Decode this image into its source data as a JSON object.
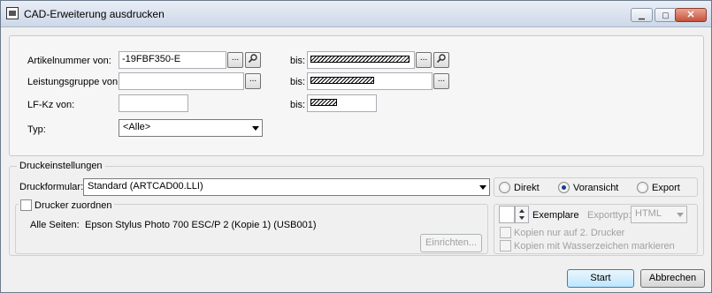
{
  "window": {
    "title": "CAD-Erweiterung ausdrucken",
    "min_label": "▁",
    "max_label": "▢",
    "close_label": "✕"
  },
  "filters": {
    "artikel_von_label": "Artikelnummer von:",
    "artikel_von_value": "-19FBF350-E",
    "artikel_bis_label": "bis:",
    "leistung_von_label": "Leistungsgruppe von:",
    "leistung_bis_label": "bis:",
    "lfkz_von_label": "LF-Kz von:",
    "lfkz_bis_label": "bis:",
    "typ_label": "Typ:",
    "typ_value": "<Alle>",
    "browse_label": "...",
    "search_icon": "magnifier-icon"
  },
  "print": {
    "group_title": "Druckeinstellungen",
    "formular_label": "Druckformular:",
    "formular_value": "Standard (ARTCAD00.LLI)",
    "radio_direkt": "Direkt",
    "radio_voransicht": "Voransicht",
    "radio_export": "Export",
    "selected_output": "Voransicht",
    "drucker_zuordnen_label": "Drucker zuordnen",
    "alle_seiten_label": "Alle Seiten:",
    "printer_name": "Epson Stylus Photo 700 ESC/P 2 (Kopie 1) (USB001)",
    "einrichten_label": "Einrichten...",
    "exemplare_value": "",
    "exemplare_label": "Exemplare",
    "exporttyp_label": "Exporttyp:",
    "exporttyp_value": "HTML",
    "kopien_drucker_label": "Kopien nur auf 2. Drucker",
    "kopien_wasserzeichen_label": "Kopien mit Wasserzeichen markieren"
  },
  "actions": {
    "start_label": "Start",
    "abbrechen_label": "Abbrechen"
  }
}
